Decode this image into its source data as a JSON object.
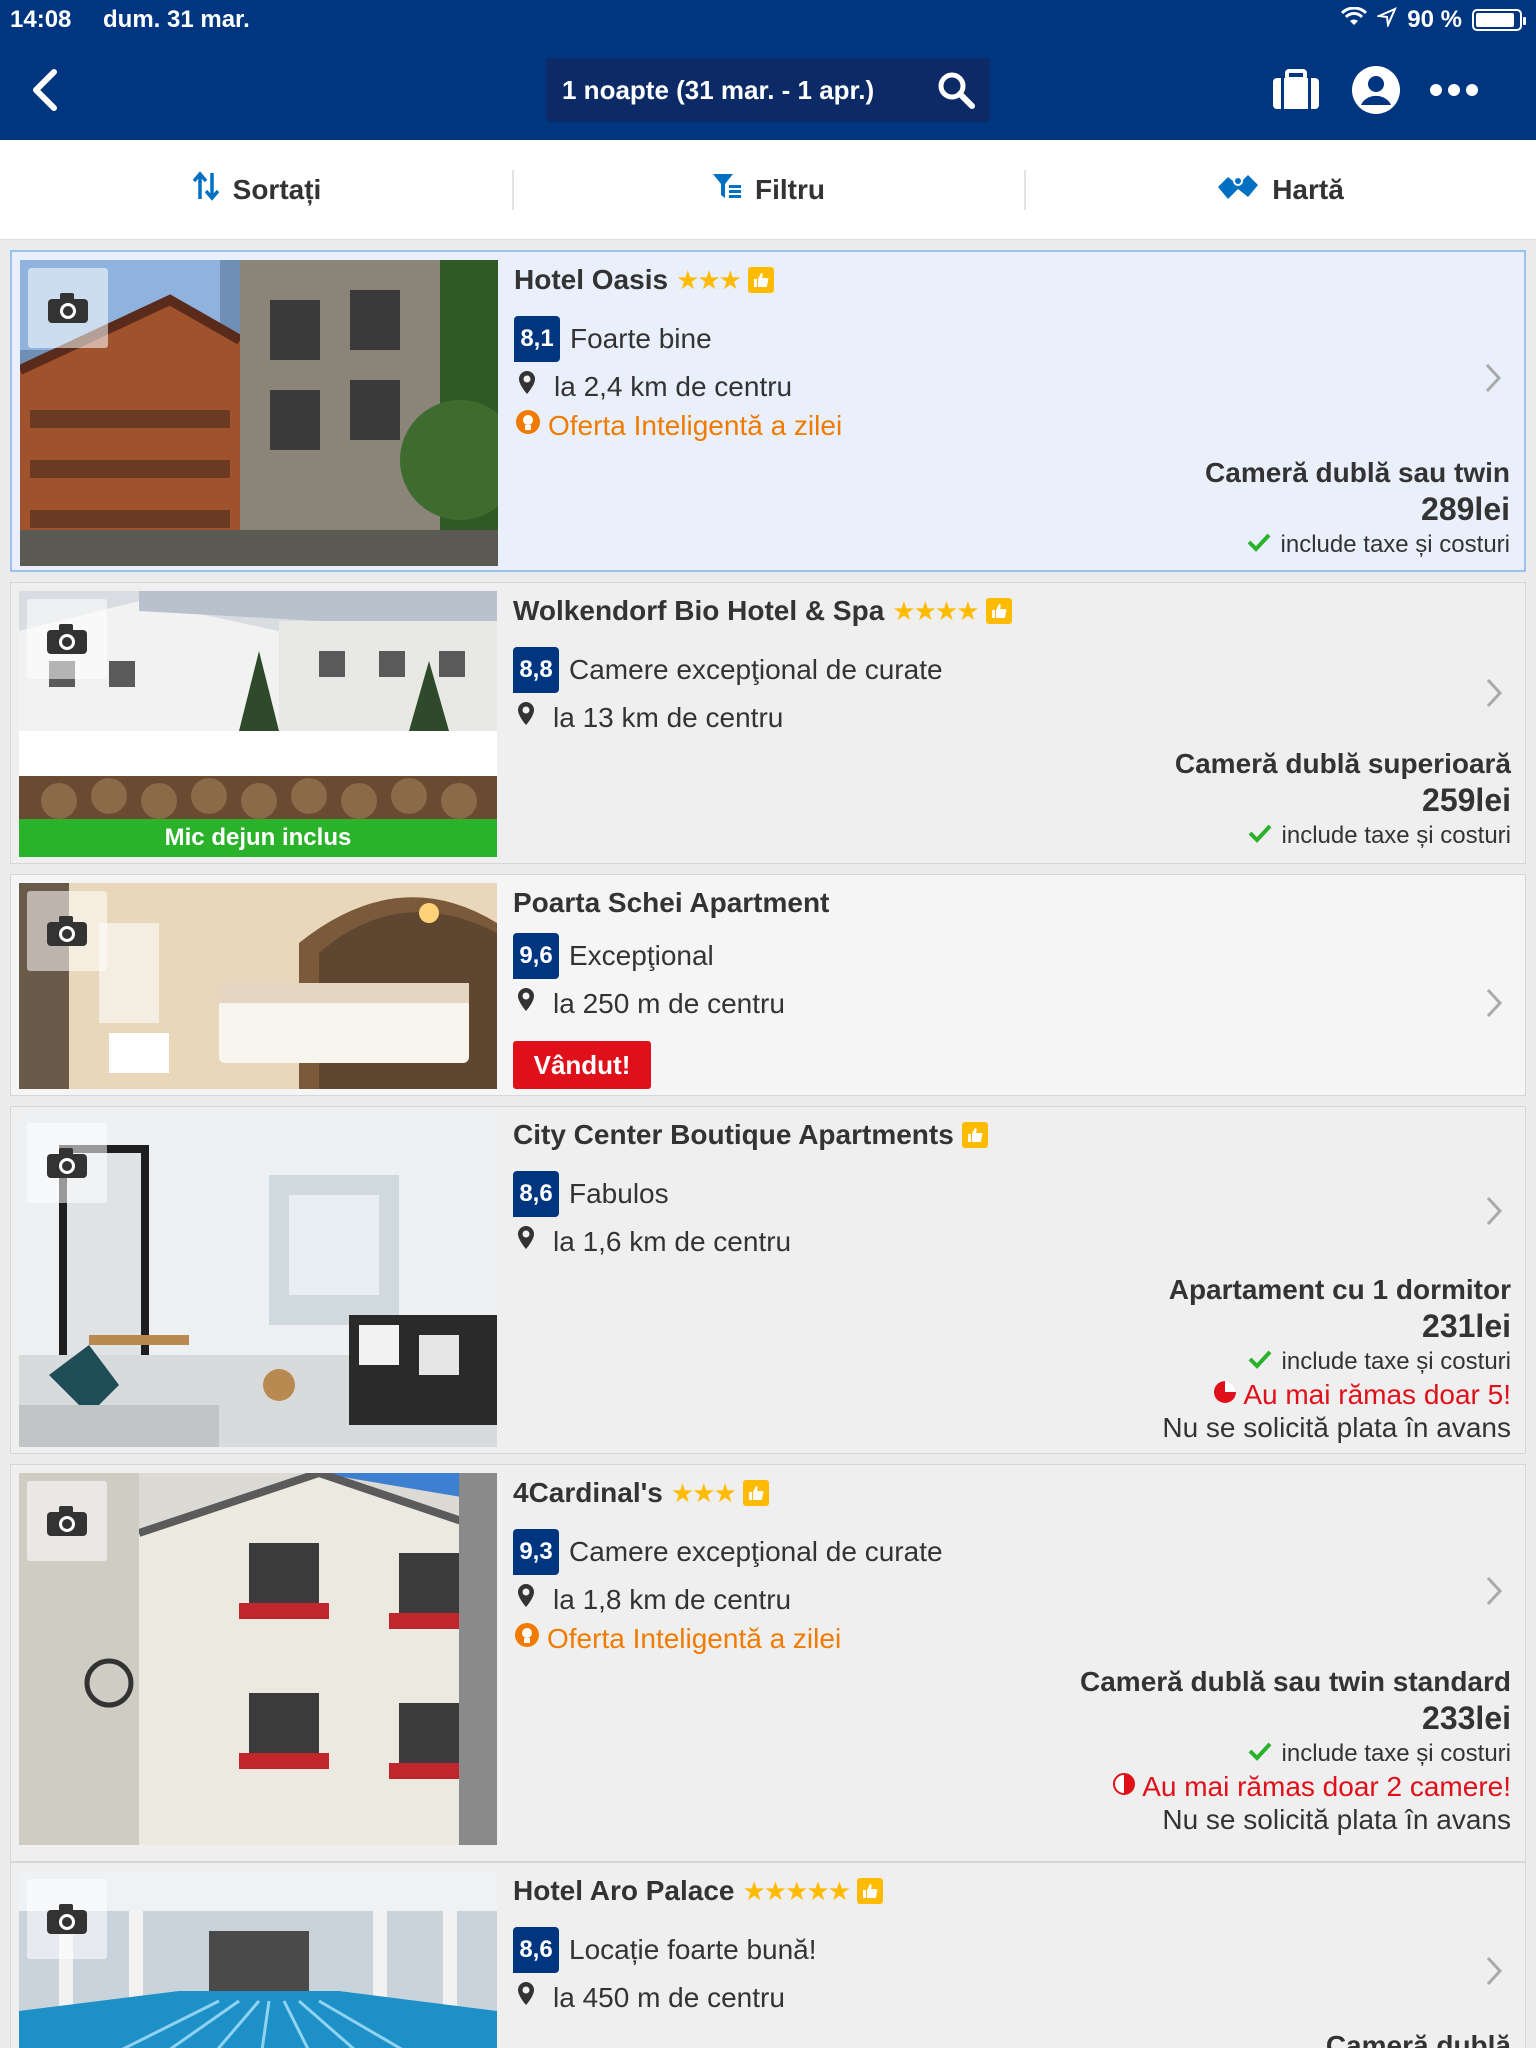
{
  "status_bar": {
    "time": "14:08",
    "date": "dum. 31 mar.",
    "battery": "90 %",
    "battery_level": 0.9
  },
  "header": {
    "search_text": "1 noapte (31 mar. - 1 apr.)"
  },
  "toolbar": {
    "sort": "Sortați",
    "filter": "Filtru",
    "map": "Hartă"
  },
  "colors": {
    "brand": "#003580",
    "accent": "#febb02",
    "deal": "#f07b00",
    "alert": "#e0101a",
    "ok": "#2bb22b"
  },
  "listings": [
    {
      "name": "Hotel Oasis",
      "stars": "★★★",
      "score": "8,1",
      "score_label": "Foarte bine",
      "distance": "la 2,4 km de centru",
      "deal": "Oferta Inteligentă a zilei",
      "room": "Cameră dublă sau twin",
      "price": "289lei",
      "taxes": "include taxe și costuri"
    },
    {
      "name": "Wolkendorf Bio Hotel & Spa",
      "stars": "★★★★",
      "score": "8,8",
      "score_label": "Camere excepţional de curate",
      "distance": "la 13 km de centru",
      "banner": "Mic dejun inclus",
      "room": "Cameră dublă superioară",
      "price": "259lei",
      "taxes": "include taxe și costuri"
    },
    {
      "name": "Poarta Schei Apartment",
      "score": "9,6",
      "score_label": "Excepţional",
      "distance": "la 250 m de centru",
      "sold": "Vândut!"
    },
    {
      "name": "City Center Boutique Apartments",
      "score": "8,6",
      "score_label": "Fabulos",
      "distance": "la 1,6 km de centru",
      "room": "Apartament cu 1 dormitor",
      "price": "231lei",
      "taxes": "include taxe și costuri",
      "scarcity": "Au mai rămas doar 5!",
      "no_prepay": "Nu se solicită plata în avans"
    },
    {
      "name": "4Cardinal's",
      "stars": "★★★",
      "score": "9,3",
      "score_label": "Camere excepţional de curate",
      "distance": "la 1,8 km de centru",
      "deal": "Oferta Inteligentă a zilei",
      "room": "Cameră dublă sau twin standard",
      "price": "233lei",
      "taxes": "include taxe și costuri",
      "scarcity": "Au mai rămas doar 2 camere!",
      "no_prepay": "Nu se solicită plata în avans"
    },
    {
      "name": "Hotel Aro Palace",
      "stars": "★★★★★",
      "score": "8,6",
      "score_label": "Locație foarte bună!",
      "distance": "la 450 m de centru",
      "room": "Cameră dublă"
    }
  ]
}
